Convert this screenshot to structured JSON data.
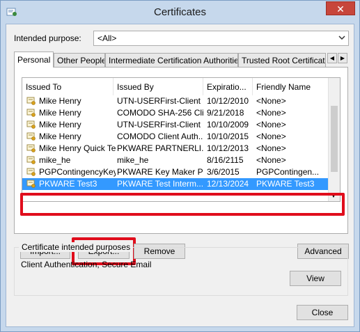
{
  "window": {
    "title": "Certificates",
    "close_glyph": "✕"
  },
  "intended_purpose": {
    "label": "Intended purpose:",
    "value": "<All>"
  },
  "tabs": [
    {
      "label": "Personal",
      "active": true
    },
    {
      "label": "Other People"
    },
    {
      "label": "Intermediate Certification Authorities"
    },
    {
      "label": "Trusted Root Certification Authorities"
    }
  ],
  "columns": [
    "Issued To",
    "Issued By",
    "Expiratio...",
    "Friendly Name"
  ],
  "rows": [
    [
      "Mike Henry",
      "UTN-USERFirst-Client ...",
      "10/12/2010",
      "<None>"
    ],
    [
      "Mike Henry",
      "COMODO SHA-256 Cli...",
      "9/21/2018",
      "<None>"
    ],
    [
      "Mike Henry",
      "UTN-USERFirst-Client ...",
      "10/10/2009",
      "<None>"
    ],
    [
      "Mike Henry",
      "COMODO Client Auth...",
      "10/10/2015",
      "<None>"
    ],
    [
      "Mike Henry Quick Test",
      "PKWARE PARTNERLI...",
      "10/12/2013",
      "<None>"
    ],
    [
      "mike_he",
      "mike_he",
      "8/16/2115",
      "<None>"
    ],
    [
      "PGPContingencyKey",
      "PKWARE Key Maker Pr...",
      "3/6/2015",
      "PGPContingen..."
    ],
    [
      "PKWARE Test3",
      "PKWARE Test Interm...",
      "12/13/2024",
      "PKWARE Test3"
    ]
  ],
  "selected_row": 7,
  "buttons": {
    "import": "Import...",
    "export": "Export...",
    "remove": "Remove",
    "advanced": "Advanced",
    "view": "View",
    "close": "Close"
  },
  "purposes": {
    "title": "Certificate intended purposes",
    "value": "Client Authentication, Secure Email"
  },
  "colors": {
    "selection": "#3399ff",
    "highlight": "#e00d1c"
  },
  "icons": {
    "app": "certificate-app-icon",
    "row": "certificate-icon"
  }
}
